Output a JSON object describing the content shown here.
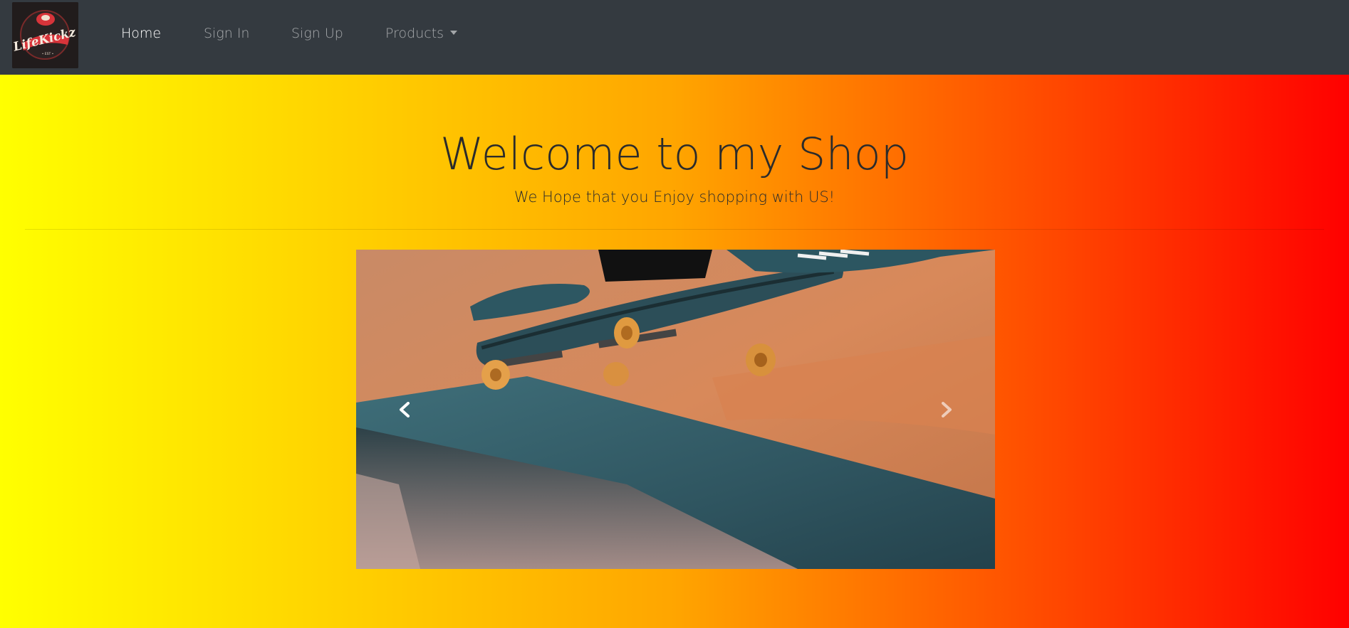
{
  "navbar": {
    "logo_alt": "LifeKickz",
    "items": [
      {
        "label": "Home",
        "active": true
      },
      {
        "label": "Sign In",
        "active": false
      },
      {
        "label": "Sign Up",
        "active": false
      },
      {
        "label": "Products",
        "active": false,
        "dropdown": true
      }
    ]
  },
  "hero": {
    "title": "Welcome to my Shop",
    "subtitle": "We Hope that you Enjoy shopping with US!"
  },
  "carousel": {
    "image_alt": "skateboard"
  },
  "colors": {
    "navbar_bg": "#343a40",
    "gradient_start": "#ffff00",
    "gradient_mid": "#ffa500",
    "gradient_end": "#ff0000",
    "logo_red": "#d8343a"
  }
}
